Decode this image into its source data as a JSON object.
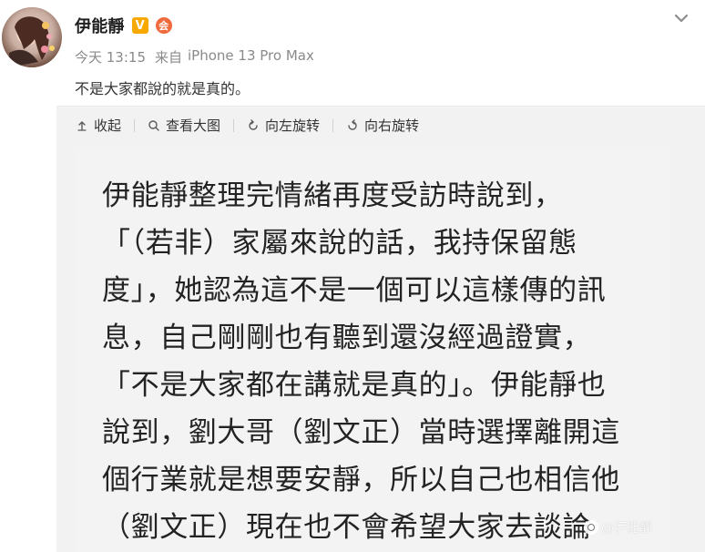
{
  "post": {
    "author": {
      "name": "伊能靜",
      "badges": {
        "verified": "V",
        "member": "会"
      }
    },
    "meta": {
      "time": "今天 13:15",
      "source_prefix": "来自",
      "device": "iPhone 13 Pro Max"
    },
    "text": "不是大家都說的就是真的。"
  },
  "media_toolbar": {
    "collapse": "收起",
    "view_large": "查看大图",
    "rotate_left": "向左旋转",
    "rotate_right": "向右旋转"
  },
  "image": {
    "lines": [
      "伊能靜整理完情緒再度受訪時說到，",
      "「（若非）家屬來說的話，我持保留態",
      "度」，她認為這不是一個可以這樣傳的訊",
      "息，自己剛剛也有聽到還沒經過證實，",
      "「不是大家都在講就是真的」。伊能靜也",
      "說到，劉大哥（劉文正）當時選擇離開這",
      "個行業就是想要安靜，所以自己也相信他",
      "（劉文正）現在也不會希望大家去談論"
    ],
    "watermark": "@伊能靜"
  },
  "colors": {
    "text": "#1f1f1f",
    "secondary_text": "#8a8a8a",
    "media_bg": "#f2f2f2",
    "vbadge": "#f7a900",
    "member_badge": "#f06b3c"
  },
  "icons": {
    "more": "chevron-down-icon",
    "collapse": "arrow-up-icon",
    "view_large": "magnifier-icon",
    "rotate_left": "rotate-left-icon",
    "rotate_right": "rotate-right-icon",
    "watermark_logo": "weibo-logo-icon"
  }
}
